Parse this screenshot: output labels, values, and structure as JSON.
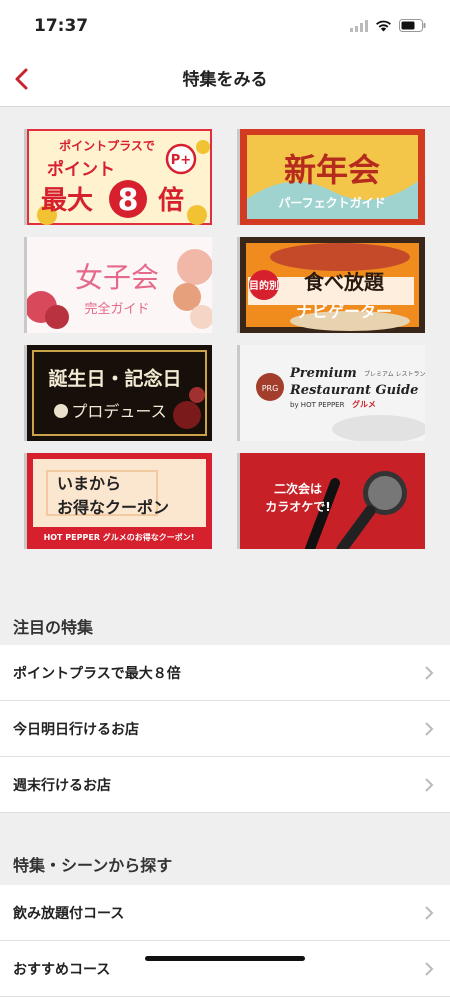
{
  "status": {
    "time": "17:37"
  },
  "nav": {
    "title": "特集をみる"
  },
  "banners": {
    "b1": {
      "line1": "ポイントプラスで",
      "line2": "ポイント",
      "line3": "最大",
      "num": "8",
      "unit": "倍",
      "badge": "P+"
    },
    "b2": {
      "title": "新年会",
      "sub": "パーフェクトガイド"
    },
    "b3": {
      "title": "女子会",
      "sub": "完全ガイド"
    },
    "b4": {
      "tag": "目的別",
      "title": "食べ放題",
      "sub": "ナビゲーター"
    },
    "b5": {
      "title": "誕生日・記念日",
      "sub": "プロデュース"
    },
    "b6": {
      "title1": "Premium",
      "title2": "Restaurant Guide",
      "jp": "プレミアム レストラン ガイド",
      "by": "by HOT PEPPER",
      "brand": "グルメ"
    },
    "b7": {
      "line1": "いまから",
      "line2": "お得なクーポン",
      "footer": "HOT PEPPER グルメのお得なクーポン!"
    },
    "b8": {
      "line1": "二次会は",
      "line2": "カラオケで!"
    }
  },
  "featured": {
    "heading": "注目の特集",
    "items": [
      "ポイントプラスで最大８倍",
      "今日明日行けるお店",
      "週末行けるお店"
    ]
  },
  "scenes": {
    "heading": "特集・シーンから探す",
    "items": [
      "飲み放題付コース",
      "おすすめコース"
    ]
  },
  "colors": {
    "accent": "#c8232c",
    "background": "#efefef"
  }
}
